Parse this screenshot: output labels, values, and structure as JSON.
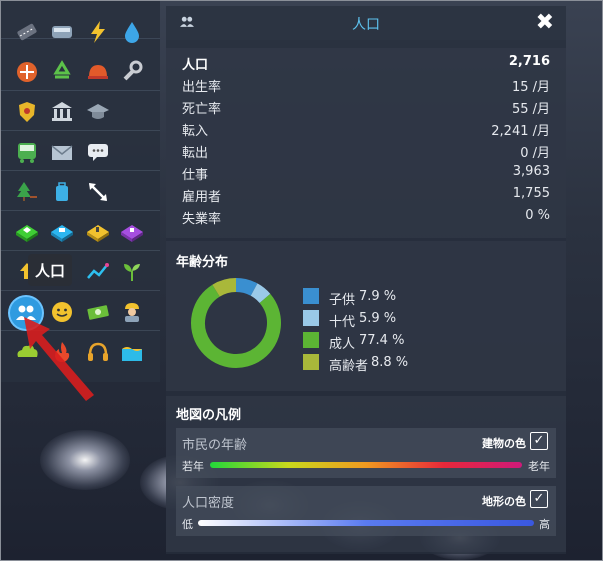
{
  "panel": {
    "title": "人口",
    "close_label": "✖"
  },
  "tooltip": "人口",
  "stats": [
    {
      "label": "人口",
      "value": "2,716"
    },
    {
      "label": "出生率",
      "value": "15 /月"
    },
    {
      "label": "死亡率",
      "value": "55 /月"
    },
    {
      "label": "転入",
      "value": "2,241 /月"
    },
    {
      "label": "転出",
      "value": "0 /月"
    },
    {
      "label": "仕事",
      "value": "3,963"
    },
    {
      "label": "雇用者",
      "value": "1,755"
    },
    {
      "label": "失業率",
      "value": "0 %"
    }
  ],
  "age_distribution": {
    "title": "年齢分布",
    "segments": [
      {
        "name": "子供",
        "percent_label": "7.9 %",
        "value": 7.9,
        "color": "#3a8fd0"
      },
      {
        "name": "十代",
        "percent_label": "5.9 %",
        "value": 5.9,
        "color": "#9ac9e8"
      },
      {
        "name": "成人",
        "percent_label": "77.4 %",
        "value": 77.4,
        "color": "#5cb534"
      },
      {
        "name": "高齢者",
        "percent_label": "8.8 %",
        "value": 8.8,
        "color": "#a9b83a"
      }
    ]
  },
  "map_legend": {
    "title": "地図の凡例",
    "items": [
      {
        "title": "市民の年齢",
        "check_label": "建物の色",
        "checked": true,
        "left_end": "若年",
        "right_end": "老年"
      },
      {
        "title": "人口密度",
        "check_label": "地形の色",
        "checked": true,
        "left_end": "低",
        "right_end": "高"
      }
    ]
  },
  "toolbar": {
    "icons": [
      "road-icon",
      "bus-icon",
      "electricity-icon",
      "water-icon",
      "fire-icon",
      "recycle-icon",
      "fire-station-icon",
      "wrench-icon",
      "police-icon",
      "government-icon",
      "education-icon",
      "transit-icon",
      "mail-icon",
      "chat-icon",
      "park-icon",
      "luggage-icon",
      "arrows-icon",
      "residential-zone-icon",
      "commercial-zone-icon",
      "industrial-zone-icon",
      "office-zone-icon",
      "population-icon",
      "happiness-icon",
      "money-icon",
      "workers-icon",
      "pollution-icon",
      "fire-hazard-icon",
      "noise-icon",
      "land-value-icon",
      "growth-icon",
      "nature-icon"
    ],
    "selected": "population-icon"
  }
}
